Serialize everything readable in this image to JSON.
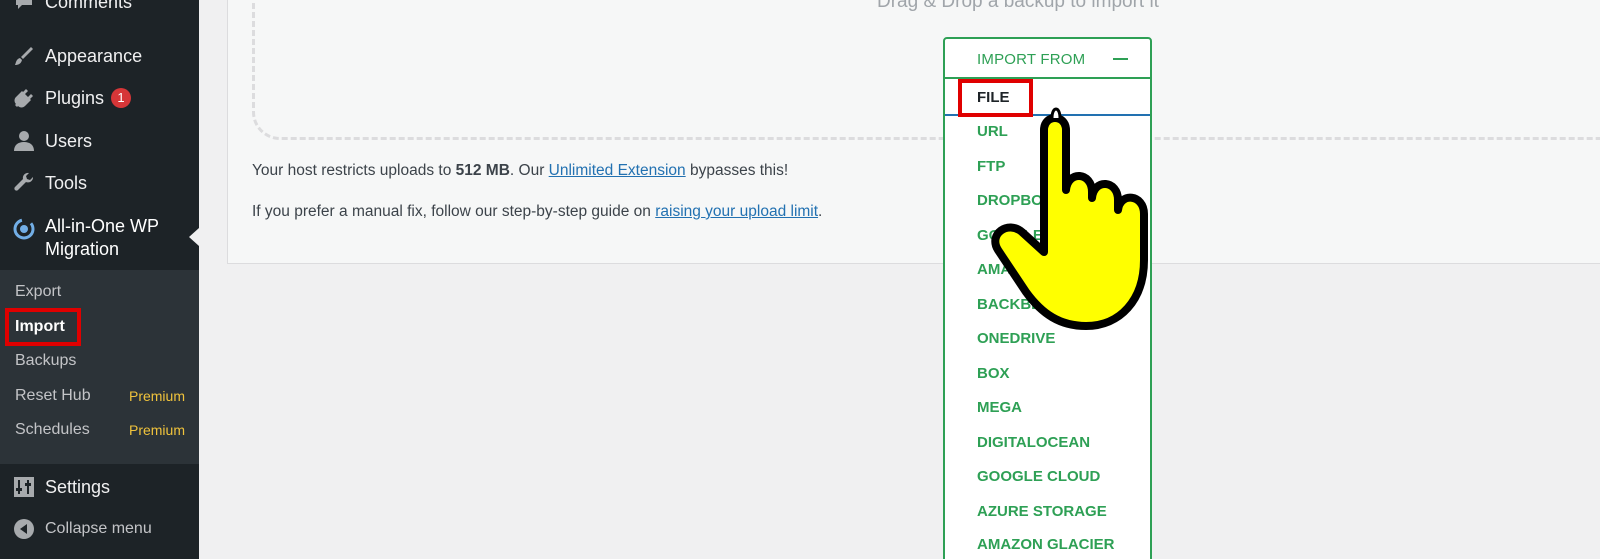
{
  "sidebar": {
    "items": [
      {
        "label": "Comments",
        "icon": "comments-icon"
      },
      {
        "label": "Appearance",
        "icon": "paintbrush-icon"
      },
      {
        "label": "Plugins",
        "icon": "plugin-icon",
        "badge": "1"
      },
      {
        "label": "Users",
        "icon": "users-icon"
      },
      {
        "label": "Tools",
        "icon": "wrench-icon"
      }
    ],
    "active": {
      "label": "All-in-One WP Migration",
      "icon": "migration-icon"
    },
    "submenu": [
      {
        "label": "Export"
      },
      {
        "label": "Import"
      },
      {
        "label": "Backups"
      },
      {
        "label": "Reset Hub",
        "tag": "Premium"
      },
      {
        "label": "Schedules",
        "tag": "Premium"
      }
    ],
    "settings": {
      "label": "Settings",
      "icon": "settings-icon"
    },
    "collapse": {
      "label": "Collapse menu",
      "icon": "collapse-icon"
    }
  },
  "main": {
    "drop_text": "Drag & Drop a backup to import it",
    "info1": {
      "prefix": "Your host restricts uploads to ",
      "size": "512 MB",
      "mid": ". Our ",
      "link": "Unlimited Extension",
      "suffix": " bypasses this!"
    },
    "info2": {
      "prefix": "If you prefer a manual fix, follow our step-by-step guide on ",
      "link": "raising your upload limit",
      "suffix": "."
    }
  },
  "dropdown": {
    "header": "IMPORT FROM",
    "options": [
      "FILE",
      "URL",
      "FTP",
      "DROPBOX",
      "GOOGLE DRIVE",
      "AMAZON S3",
      "BACKBLAZE B2",
      "ONEDRIVE",
      "BOX",
      "MEGA",
      "DIGITALOCEAN",
      "GOOGLE CLOUD",
      "AZURE STORAGE",
      "AMAZON GLACIER"
    ],
    "selected": "FILE"
  },
  "colors": {
    "sidebar_bg": "#1d2327",
    "submenu_bg": "#2c3338",
    "accent_green": "#2ea055",
    "highlight_red": "#e00000",
    "premium": "#f0c33c",
    "link": "#2271b1"
  }
}
